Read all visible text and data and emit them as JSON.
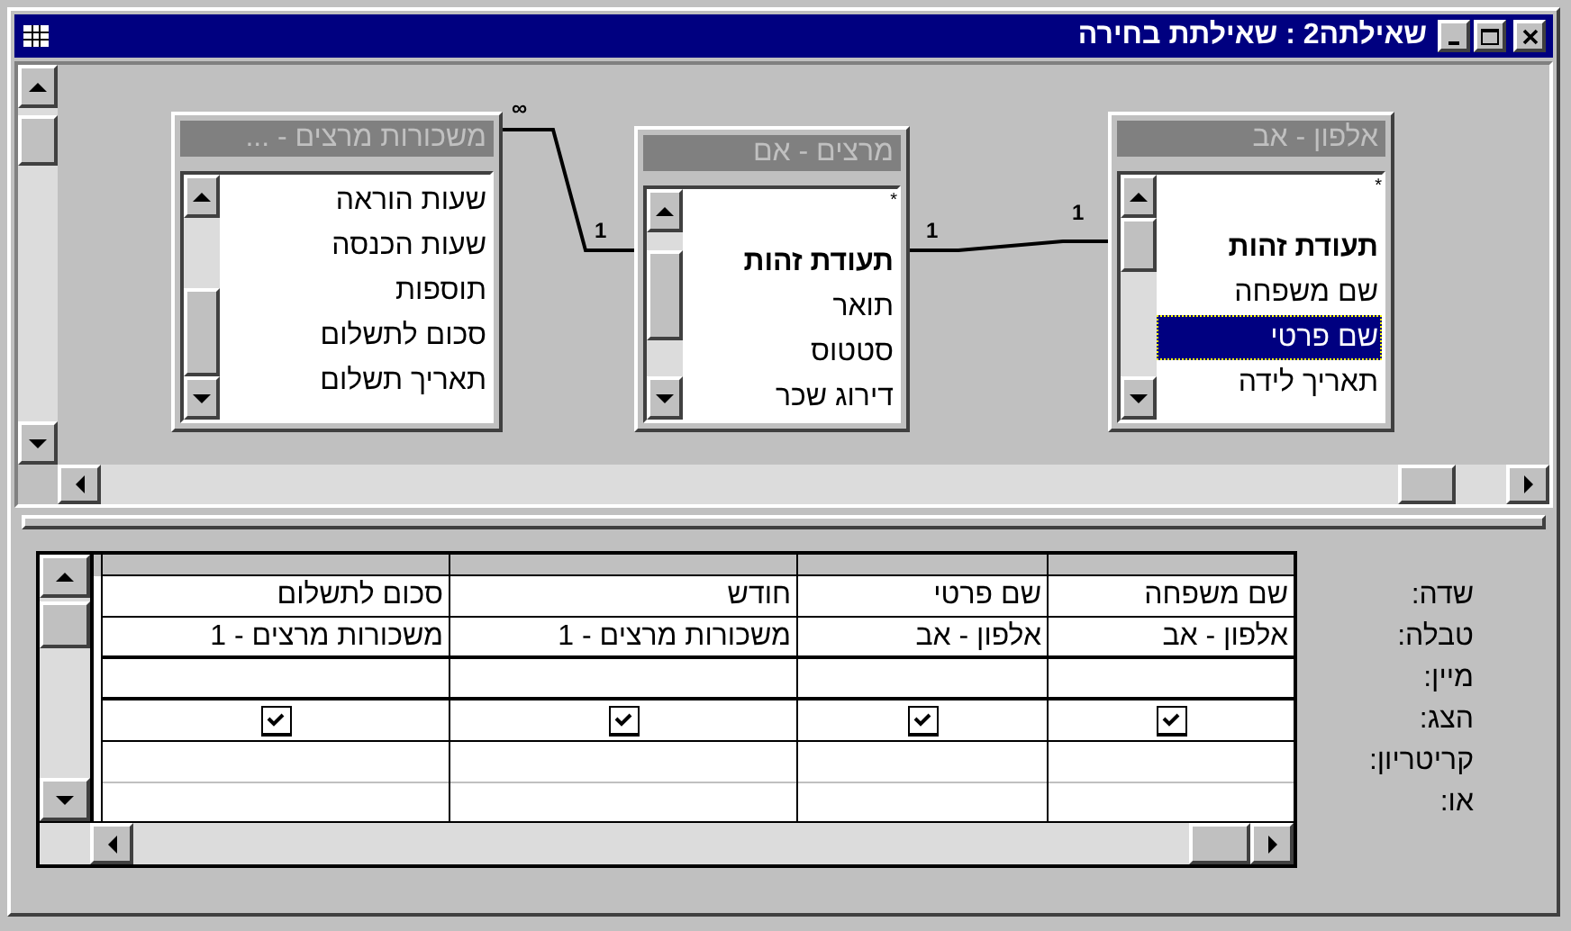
{
  "window": {
    "title": "שאילתה2 : שאילתת בחירה"
  },
  "field_lists": [
    {
      "title": "אלפון - אב",
      "fields": [
        {
          "name": "*",
          "kind": "all"
        },
        {
          "name": "תעודת זהות",
          "kind": "field",
          "key": true,
          "selected": false
        },
        {
          "name": "שם משפחה",
          "kind": "field",
          "key": false,
          "selected": false
        },
        {
          "name": "שם פרטי",
          "kind": "field",
          "key": false,
          "selected": true
        },
        {
          "name": "תאריך לידה",
          "kind": "field",
          "key": false,
          "selected": false
        }
      ]
    },
    {
      "title": "מרצים - אם",
      "fields": [
        {
          "name": "*",
          "kind": "all"
        },
        {
          "name": "תעודת זהות",
          "kind": "field",
          "key": true,
          "selected": false
        },
        {
          "name": "תואר",
          "kind": "field",
          "key": false,
          "selected": false
        },
        {
          "name": "סטטוס",
          "kind": "field",
          "key": false,
          "selected": false
        },
        {
          "name": "דירוג שכר",
          "kind": "field",
          "key": false,
          "selected": false
        }
      ]
    },
    {
      "title": "משכורות מרצים - ...",
      "fields": [
        {
          "name": "שעות הוראה",
          "kind": "field",
          "key": false,
          "selected": false
        },
        {
          "name": "שעות הכנסה",
          "kind": "field",
          "key": false,
          "selected": false
        },
        {
          "name": "תוספות",
          "kind": "field",
          "key": false,
          "selected": false
        },
        {
          "name": "סכום לתשלום",
          "kind": "field",
          "key": false,
          "selected": false
        },
        {
          "name": "תאריך תשלום",
          "kind": "field",
          "key": false,
          "selected": false
        }
      ]
    }
  ],
  "relationships": [
    {
      "start_label": "1",
      "end_label": "1"
    },
    {
      "start_label": "1",
      "end_label": "∞"
    }
  ],
  "grid": {
    "row_labels": [
      "שדה:",
      "טבלה:",
      "מיין:",
      "הצג:",
      "קריטריון:",
      "או:"
    ],
    "columns": [
      {
        "field": "שם משפחה",
        "table": "אלפון - אב",
        "show": true
      },
      {
        "field": "שם פרטי",
        "table": "אלפון - אב",
        "show": true
      },
      {
        "field": "חודש",
        "table": "משכורות מרצים - 1",
        "show": true
      },
      {
        "field": "סכום לתשלום",
        "table": "משכורות מרצים - 1",
        "show": true
      }
    ]
  }
}
